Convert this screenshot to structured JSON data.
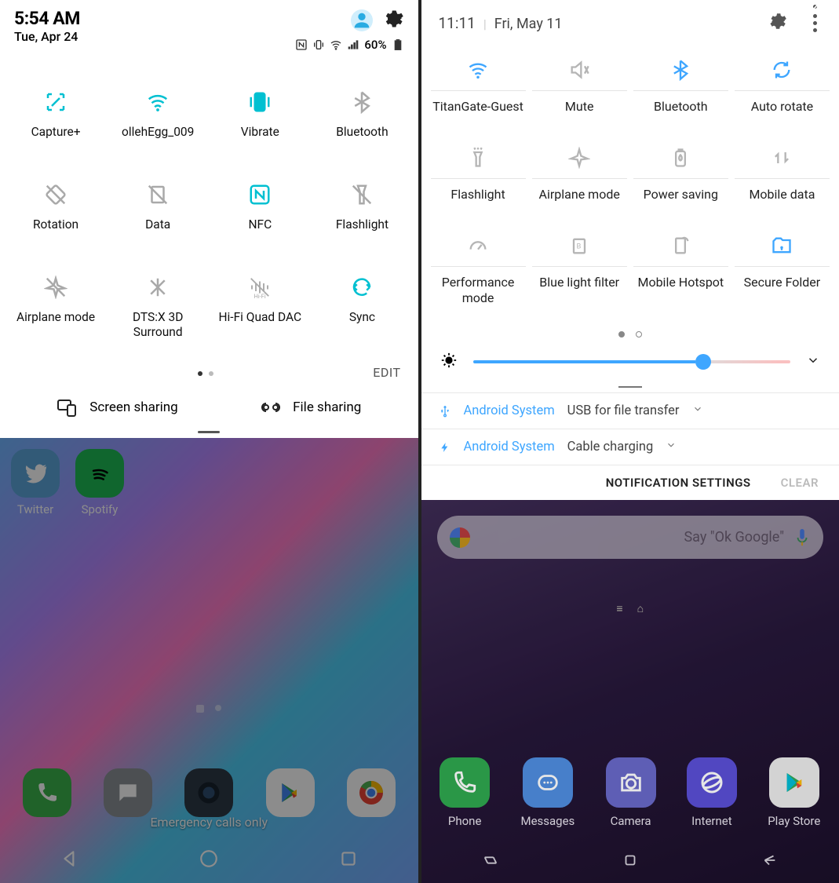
{
  "left": {
    "status": {
      "time": "5:54 AM",
      "date": "Tue, Apr 24",
      "battery_pct": "60%"
    },
    "qs": {
      "tiles": [
        {
          "label": "Capture+",
          "on": true
        },
        {
          "label": "ollehEgg_009",
          "on": true
        },
        {
          "label": "Vibrate",
          "on": true
        },
        {
          "label": "Bluetooth",
          "on": false
        },
        {
          "label": "Rotation",
          "on": false
        },
        {
          "label": "Data",
          "on": false
        },
        {
          "label": "NFC",
          "on": true
        },
        {
          "label": "Flashlight",
          "on": false
        },
        {
          "label": "Airplane mode",
          "on": false
        },
        {
          "label": "DTS:X 3D Surround",
          "on": false
        },
        {
          "label": "Hi-Fi Quad DAC",
          "on": false
        },
        {
          "label": "Sync",
          "on": true
        }
      ],
      "edit": "EDIT",
      "screen_sharing": "Screen sharing",
      "file_sharing": "File sharing"
    },
    "home": {
      "apps": [
        {
          "label": "Twitter"
        },
        {
          "label": "Spotify"
        }
      ],
      "emergency": "Emergency calls only"
    }
  },
  "right": {
    "status": {
      "time": "11:11",
      "date": "Fri, May 11",
      "badge": "2"
    },
    "qs": {
      "tiles": [
        {
          "label": "TitanGate-Guest",
          "on": true
        },
        {
          "label": "Mute",
          "on": false
        },
        {
          "label": "Bluetooth",
          "on": true
        },
        {
          "label": "Auto rotate",
          "on": true
        },
        {
          "label": "Flashlight",
          "on": false
        },
        {
          "label": "Airplane mode",
          "on": false
        },
        {
          "label": "Power saving",
          "on": false
        },
        {
          "label": "Mobile data",
          "on": false
        },
        {
          "label": "Performance mode",
          "on": false
        },
        {
          "label": "Blue light filter",
          "on": false
        },
        {
          "label": "Mobile Hotspot",
          "on": false
        },
        {
          "label": "Secure Folder",
          "on": true
        }
      ],
      "brightness_pct": 70
    },
    "notifs": [
      {
        "app": "Android System",
        "msg": "USB for file transfer"
      },
      {
        "app": "Android System",
        "msg": "Cable charging"
      }
    ],
    "actions": {
      "settings": "NOTIFICATION SETTINGS",
      "clear": "CLEAR"
    },
    "home": {
      "search_hint": "Say \"Ok Google\"",
      "dock": [
        {
          "label": "Phone"
        },
        {
          "label": "Messages"
        },
        {
          "label": "Camera"
        },
        {
          "label": "Internet"
        },
        {
          "label": "Play Store"
        }
      ]
    }
  }
}
